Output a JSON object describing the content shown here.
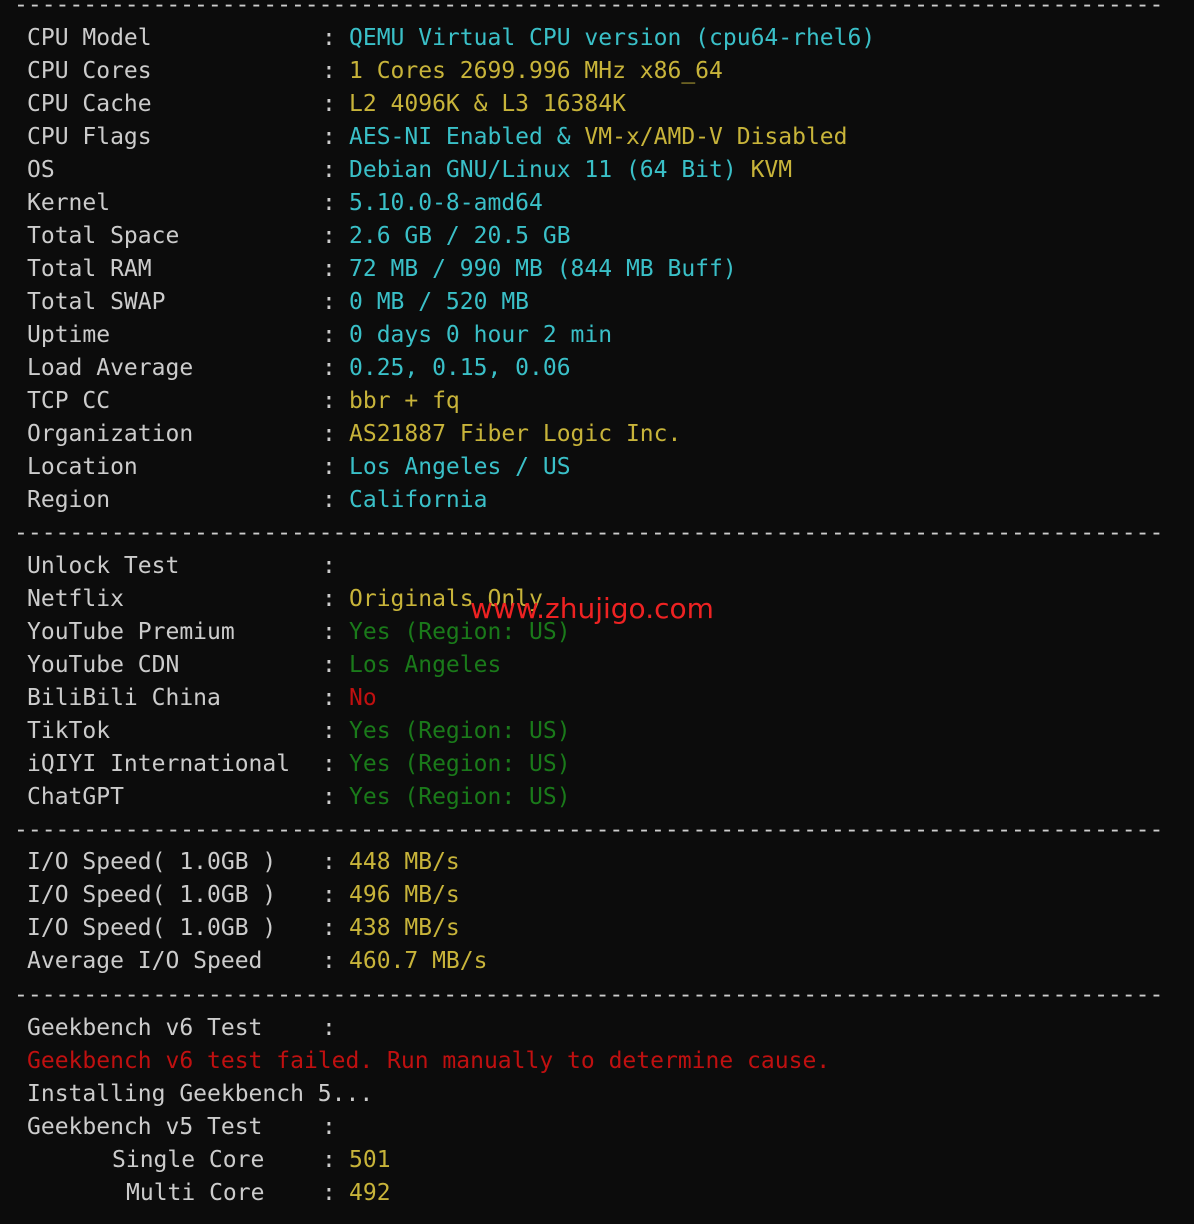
{
  "separator": "-----------------------------------------------------------------------------------",
  "system": [
    {
      "label": "CPU Model",
      "value": "QEMU Virtual CPU version (cpu64-rhel6)",
      "color": "cyan"
    },
    {
      "label": "CPU Cores",
      "value": "1 Cores 2699.996 MHz x86_64",
      "color": "yellow"
    },
    {
      "label": "CPU Cache",
      "value": "L2 4096K & L3 16384K",
      "color": "yellow"
    },
    {
      "label": "CPU Flags",
      "value": "AES-NI Enabled & VM-x/AMD-V Disabled",
      "color": "cyan_yellow"
    },
    {
      "label": "OS",
      "value": "Debian GNU/Linux 11 (64 Bit) KVM",
      "color": "cyan_yellow"
    },
    {
      "label": "Kernel",
      "value": "5.10.0-8-amd64",
      "color": "cyan"
    },
    {
      "label": "Total Space",
      "value": "2.6 GB / 20.5 GB",
      "color": "cyan"
    },
    {
      "label": "Total RAM",
      "value": "72 MB / 990 MB (844 MB Buff)",
      "color": "cyan"
    },
    {
      "label": "Total SWAP",
      "value": "0 MB / 520 MB",
      "color": "cyan"
    },
    {
      "label": "Uptime",
      "value": "0 days 0 hour 2 min",
      "color": "cyan"
    },
    {
      "label": "Load Average",
      "value": "0.25, 0.15, 0.06",
      "color": "cyan"
    },
    {
      "label": "TCP CC",
      "value": "bbr + fq",
      "color": "yellow"
    },
    {
      "label": "Organization",
      "value": "AS21887 Fiber Logic Inc.",
      "color": "yellow"
    },
    {
      "label": "Location",
      "value": "Los Angeles / US",
      "color": "cyan"
    },
    {
      "label": "Region",
      "value": "California",
      "color": "cyan"
    }
  ],
  "cpu_flags_parts": [
    "AES-NI Enabled & ",
    "VM-x/AMD-V Disabled"
  ],
  "os_parts": [
    "Debian GNU/Linux 11 (64 Bit) ",
    "KVM"
  ],
  "unlock": [
    {
      "label": "Unlock Test",
      "value": "",
      "color": "white"
    },
    {
      "label": "Netflix",
      "value": "Originals Only",
      "color": "yellow"
    },
    {
      "label": "YouTube Premium",
      "value": "Yes (Region: US)",
      "color": "green"
    },
    {
      "label": "YouTube CDN",
      "value": "Los Angeles",
      "color": "green"
    },
    {
      "label": "BiliBili China",
      "value": "No",
      "color": "red"
    },
    {
      "label": "TikTok",
      "value": "Yes (Region: US)",
      "color": "green"
    },
    {
      "label": "iQIYI International",
      "value": "Yes (Region: US)",
      "color": "green"
    },
    {
      "label": "ChatGPT",
      "value": "Yes (Region: US)",
      "color": "green"
    }
  ],
  "io": [
    {
      "label": "I/O Speed( 1.0GB )",
      "value": "448 MB/s",
      "color": "yellow"
    },
    {
      "label": "I/O Speed( 1.0GB )",
      "value": "496 MB/s",
      "color": "yellow"
    },
    {
      "label": "I/O Speed( 1.0GB )",
      "value": "438 MB/s",
      "color": "yellow"
    },
    {
      "label": "Average I/O Speed",
      "value": "460.7 MB/s",
      "color": "yellow"
    }
  ],
  "geekbench": {
    "v6_label": "Geekbench v6 Test",
    "v6_error": "Geekbench v6 test failed. Run manually to determine cause.",
    "installing": "Installing Geekbench 5...",
    "v5_label": "Geekbench v5 Test",
    "single_label": "Single Core",
    "single_value": "501",
    "multi_label": "Multi Core",
    "multi_value": "492"
  },
  "colon": ":",
  "watermark": "www.zhujigo.com",
  "colors": {
    "background": "#0c0c0c",
    "text": "#cccccc",
    "cyan": "#3ac0c8",
    "yellow": "#c8b43a",
    "green": "#1a7a1a",
    "red": "#c01010",
    "watermark": "#ee2222"
  }
}
